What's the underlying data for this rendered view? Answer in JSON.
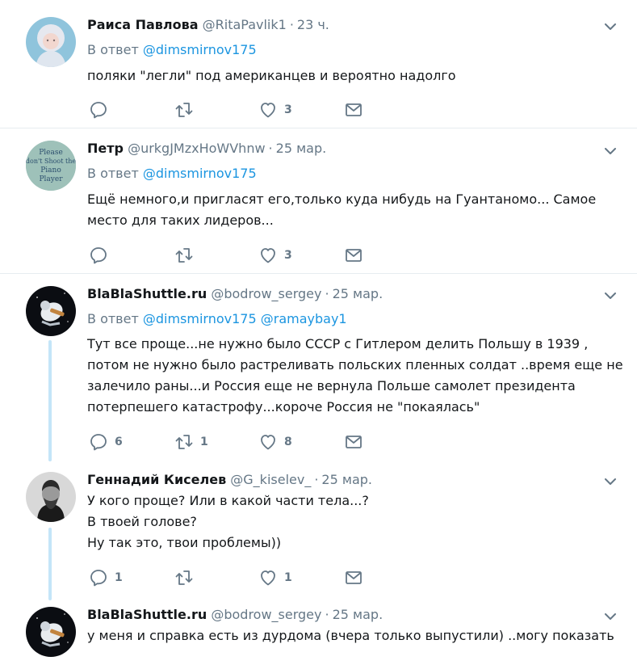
{
  "reply_prefix": "В ответ",
  "tweets": [
    {
      "name": "Раиса Павлова",
      "handle": "@RitaPavlik1",
      "time": "23 ч.",
      "mentions": "@dimsmirnov175",
      "lines": [
        "поляки \"легли\" под американцев и вероятно надолго"
      ],
      "replies": "",
      "retweets": "",
      "likes": "3"
    },
    {
      "name": "Петр",
      "handle": "@urkgJMzxHoWVhnw",
      "time": "25 мар.",
      "mentions": "@dimsmirnov175",
      "lines": [
        "Ещё немного,и пригласят его,только куда нибудь на Гуантаномо... Самое",
        "место для таких лидеров..."
      ],
      "avatar_text": [
        "Please",
        "don't Shoot the",
        "Piano",
        "Player"
      ],
      "replies": "",
      "retweets": "",
      "likes": "3"
    },
    {
      "name": "BlaBlaShuttle.ru",
      "handle": "@bodrow_sergey",
      "time": "25 мар.",
      "mentions": "@dimsmirnov175 @ramaybay1",
      "lines": [
        "Тут все проще...не нужно было СССР с Гитлером делить Польшу в 1939 ,",
        "потом не нужно было растреливать польских пленных солдат ..время еще не",
        "залечило раны...и Россия еще не вернула Польше самолет президента",
        "потерпешего катастрофу...короче Россия не \"покаялась\""
      ],
      "replies": "6",
      "retweets": "1",
      "likes": "8"
    },
    {
      "name": "Геннадий Киселев",
      "handle": "@G_kiselev_",
      "time": "25 мар.",
      "lines": [
        "У кого проще? Или в какой части тела...?",
        "В твоей голове?",
        "Ну так это, твои проблемы))"
      ],
      "replies": "1",
      "retweets": "",
      "likes": "1"
    },
    {
      "name": "BlaBlaShuttle.ru",
      "handle": "@bodrow_sergey",
      "time": "25 мар.",
      "lines": [
        "у меня и справка есть из дурдома (вчера только выпустили) ..могу показать"
      ]
    }
  ],
  "colors": {
    "text": "#14171a",
    "secondary": "#657786",
    "link": "#1b95e0",
    "thread": "#c4e5f8",
    "divider": "#e6ecf0"
  },
  "icons": [
    "reply-icon",
    "retweet-icon",
    "like-icon",
    "direct-message-icon",
    "chevron-down-icon"
  ]
}
